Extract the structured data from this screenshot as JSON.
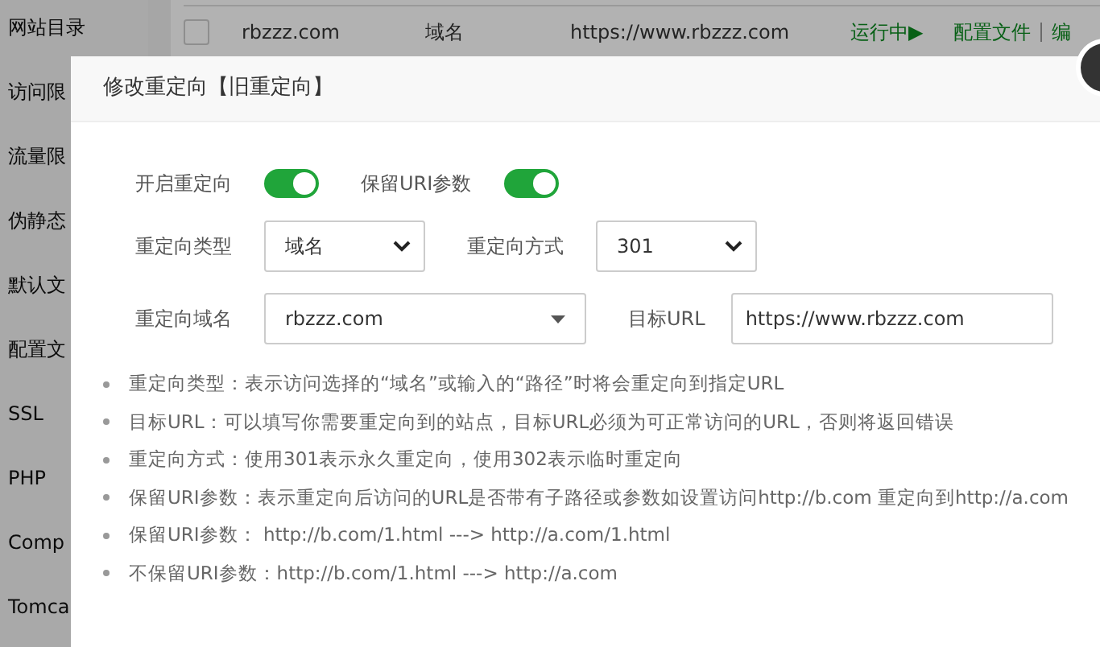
{
  "sidebar": {
    "items": [
      {
        "label": "网站目录"
      },
      {
        "label": "访问限"
      },
      {
        "label": "流量限"
      },
      {
        "label": "伪静态"
      },
      {
        "label": "默认文"
      },
      {
        "label": "配置文"
      },
      {
        "label": "SSL"
      },
      {
        "label": "PHP"
      },
      {
        "label": "Comp"
      },
      {
        "label": "Tomca"
      }
    ]
  },
  "site_row": {
    "checked": false,
    "domain": "rbzzz.com",
    "type": "域名",
    "target": "https://www.rbzzz.com",
    "status": "运行中▶",
    "actions": [
      "配置文件",
      "编"
    ]
  },
  "dialog": {
    "title": "修改重定向【旧重定向】",
    "switches": [
      {
        "label": "开启重定向",
        "on": true
      },
      {
        "label": "保留URI参数",
        "on": true
      }
    ],
    "selects": [
      {
        "label": "重定向类型",
        "value": "域名"
      },
      {
        "label": "重定向方式",
        "value": "301"
      }
    ],
    "domain_select": {
      "label": "重定向域名",
      "value": "rbzzz.com"
    },
    "target_url": {
      "label": "目标URL",
      "value": "https://www.rbzzz.com"
    },
    "notes": [
      "重定向类型：表示访问选择的“域名”或输入的“路径”时将会重定向到指定URL",
      "目标URL：可以填写你需要重定向到的站点，目标URL必须为可正常访问的URL，否则将返回错误",
      "重定向方式：使用301表示永久重定向，使用302表示临时重定向",
      "保留URI参数：表示重定向后访问的URL是否带有子路径或参数如设置访问http://b.com 重定向到http://a.com",
      "保留URI参数： http://b.com/1.html ---> http://a.com/1.html",
      "不保留URI参数：http://b.com/1.html ---> http://a.com"
    ]
  }
}
